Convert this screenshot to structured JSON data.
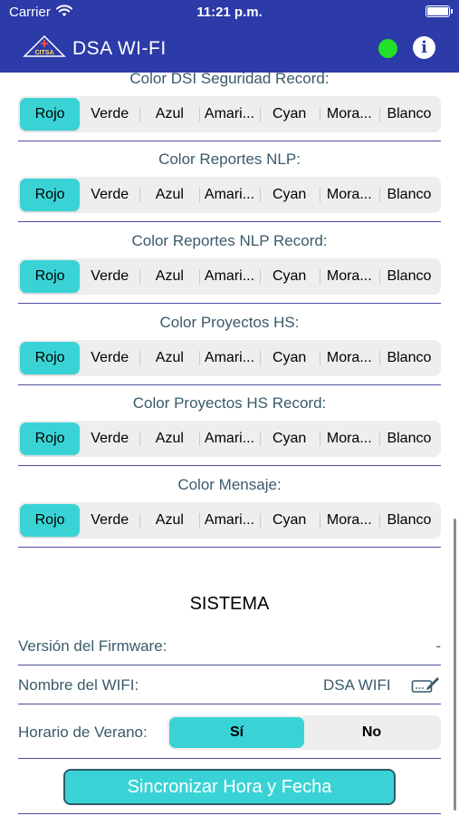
{
  "status": {
    "carrier": "Carrier",
    "time": "11:21 p.m."
  },
  "nav": {
    "title": "DSA WI-FI",
    "logo_text": "CITSA",
    "connection_color": "#22e02a"
  },
  "color_options": [
    "Rojo",
    "Verde",
    "Azul",
    "Amari...",
    "Cyan",
    "Mora...",
    "Blanco"
  ],
  "sections": [
    {
      "title": "Color DSI Seguridad Record:",
      "selected": "Rojo"
    },
    {
      "title": "Color Reportes NLP:",
      "selected": "Rojo"
    },
    {
      "title": "Color Reportes NLP Record:",
      "selected": "Rojo"
    },
    {
      "title": "Color Proyectos HS:",
      "selected": "Rojo"
    },
    {
      "title": "Color Proyectos HS Record:",
      "selected": "Rojo"
    },
    {
      "title": "Color Mensaje:",
      "selected": "Rojo"
    }
  ],
  "sistema": {
    "title": "SISTEMA",
    "firmware_label": "Versión del Firmware:",
    "firmware_value": "-",
    "wifi_label": "Nombre del WIFI:",
    "wifi_value": "DSA WIFI",
    "dst_label": "Horario de Verano:",
    "dst_options": [
      "Sí",
      "No"
    ],
    "dst_selected": "Sí",
    "sync_button": "Sincronizar Hora y Fecha"
  },
  "colors": {
    "nav_bg": "#2c3ba8",
    "accent": "#3ad3d5",
    "divider": "#4a4f9e"
  }
}
